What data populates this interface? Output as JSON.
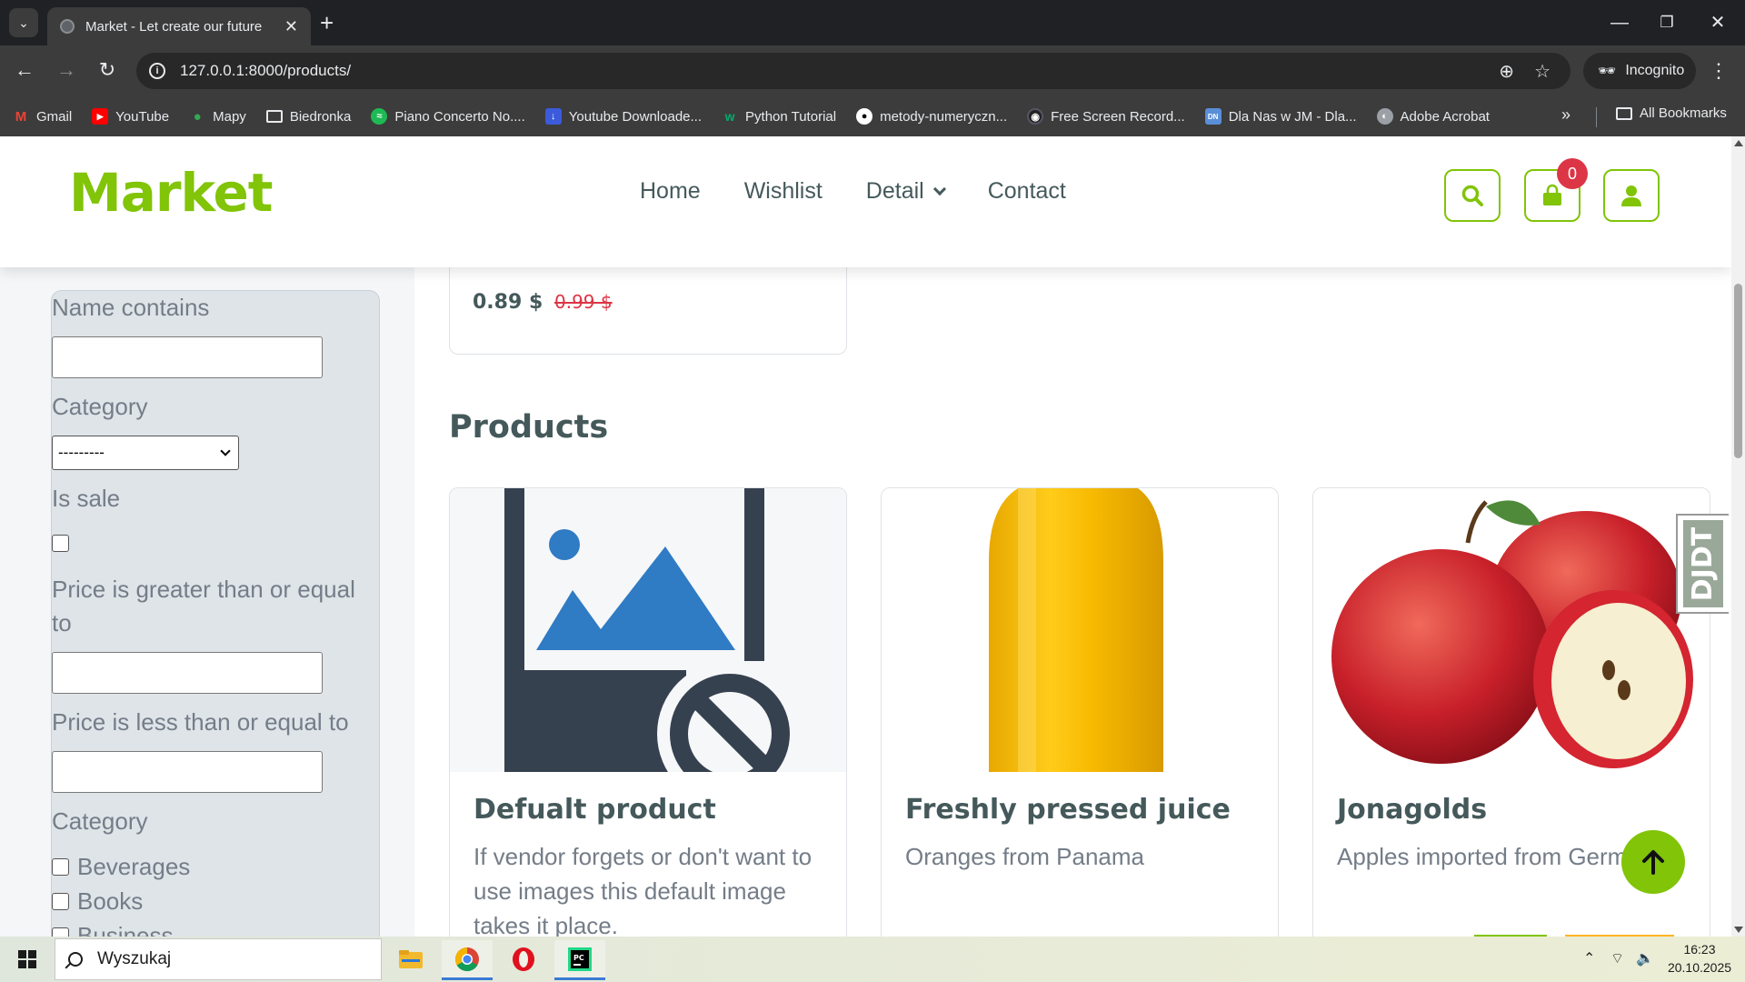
{
  "browser": {
    "tab_title": "Market - Let create our future",
    "url": "127.0.0.1:8000/products/",
    "profile_label": "Incognito",
    "bookmarks": [
      {
        "label": "Gmail",
        "icon": "gmail-icon",
        "color": "#ea4335"
      },
      {
        "label": "YouTube",
        "icon": "youtube-icon",
        "color": "#ff0000"
      },
      {
        "label": "Mapy",
        "icon": "maps-icon",
        "color": "#34a853"
      },
      {
        "label": "Biedronka",
        "icon": "folder-icon",
        "color": "#3c3c3c"
      },
      {
        "label": "Piano Concerto No....",
        "icon": "spotify-icon",
        "color": "#1db954"
      },
      {
        "label": "Youtube Downloade...",
        "icon": "download-icon",
        "color": "#3b5bdb"
      },
      {
        "label": "Python Tutorial",
        "icon": "w3schools-icon",
        "color": "#04aa6d"
      },
      {
        "label": "metody-numeryczn...",
        "icon": "github-icon",
        "color": "#ffffff"
      },
      {
        "label": "Free Screen Record...",
        "icon": "recorder-icon",
        "color": "#555577"
      },
      {
        "label": "Dla Nas w JM - Dla...",
        "icon": "dlanas-icon",
        "color": "#5a8fd8"
      },
      {
        "label": "Adobe Acrobat",
        "icon": "globe-icon",
        "color": "#9aa0a6"
      }
    ],
    "all_bookmarks_label": "All Bookmarks"
  },
  "site": {
    "logo": "Market",
    "nav": [
      {
        "label": "Home"
      },
      {
        "label": "Wishlist"
      },
      {
        "label": "Detail"
      },
      {
        "label": "Contact"
      }
    ],
    "cart_count": "0",
    "accent_color": "#81c408"
  },
  "filters": {
    "name_label": "Name contains",
    "category_label": "Category",
    "category_selected": "---------",
    "is_sale_label": "Is sale",
    "price_gte_label": "Price is greater than or equal to",
    "price_lte_label": "Price is less than or equal to",
    "category_checks_label": "Category",
    "category_options": [
      "Beverages",
      "Books",
      "Business"
    ]
  },
  "previous_card": {
    "price": "0.89 $",
    "old_price": "0.99 $"
  },
  "products": {
    "heading": "Products",
    "items": [
      {
        "title": "Defualt product",
        "description": "If vendor forgets or don't want to use images this default image takes it place.",
        "image": "default-image-icon"
      },
      {
        "title": "Freshly pressed juice",
        "description": "Oranges from Panama",
        "image": "juice-bottle-image"
      },
      {
        "title": "Jonagolds",
        "description": "Apples imported from Germany",
        "image": "apples-image"
      }
    ]
  },
  "debug_toolbar": {
    "label": "DJDT"
  },
  "taskbar": {
    "search_placeholder": "Wyszukaj",
    "time": "16:23",
    "date": "20.10.2025"
  }
}
